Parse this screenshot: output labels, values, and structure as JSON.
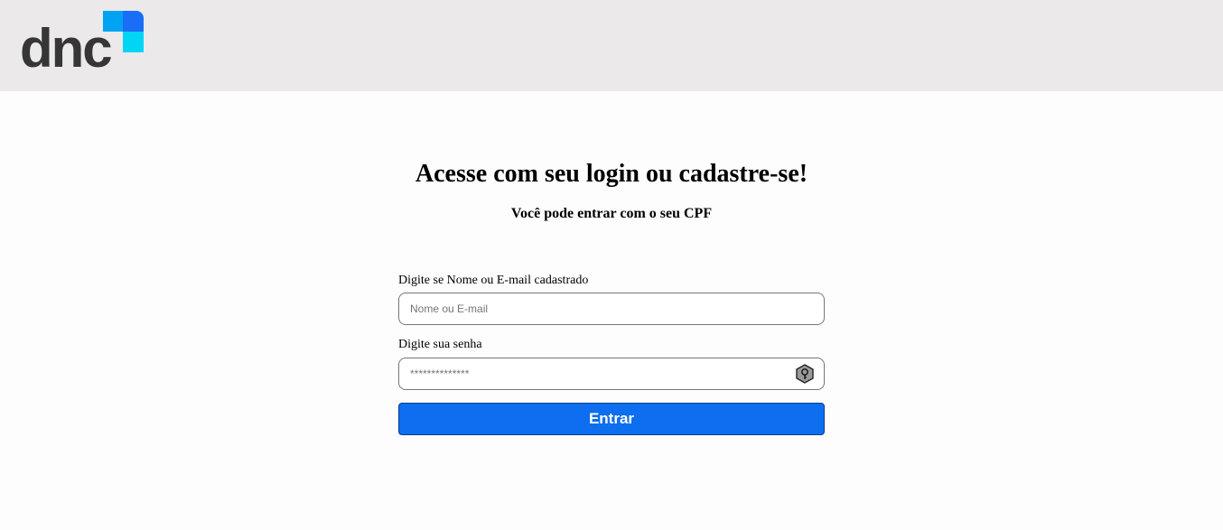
{
  "header": {
    "logo_text": "dnc",
    "logo_colors": [
      "#00a3f2",
      "#1a6ef5",
      "#00d5f5"
    ]
  },
  "login": {
    "title": "Acesse com seu login ou cadastre-se!",
    "subtitle": "Você pode entrar com o seu CPF",
    "username_label": "Digite se Nome ou E-mail cadastrado",
    "username_placeholder": "Nome ou E-mail",
    "username_value": "",
    "password_label": "Digite sua senha",
    "password_placeholder": "**************",
    "password_value": "",
    "password_icon": "key-icon",
    "submit_label": "Entrar",
    "submit_color": "#0d6ef0"
  }
}
